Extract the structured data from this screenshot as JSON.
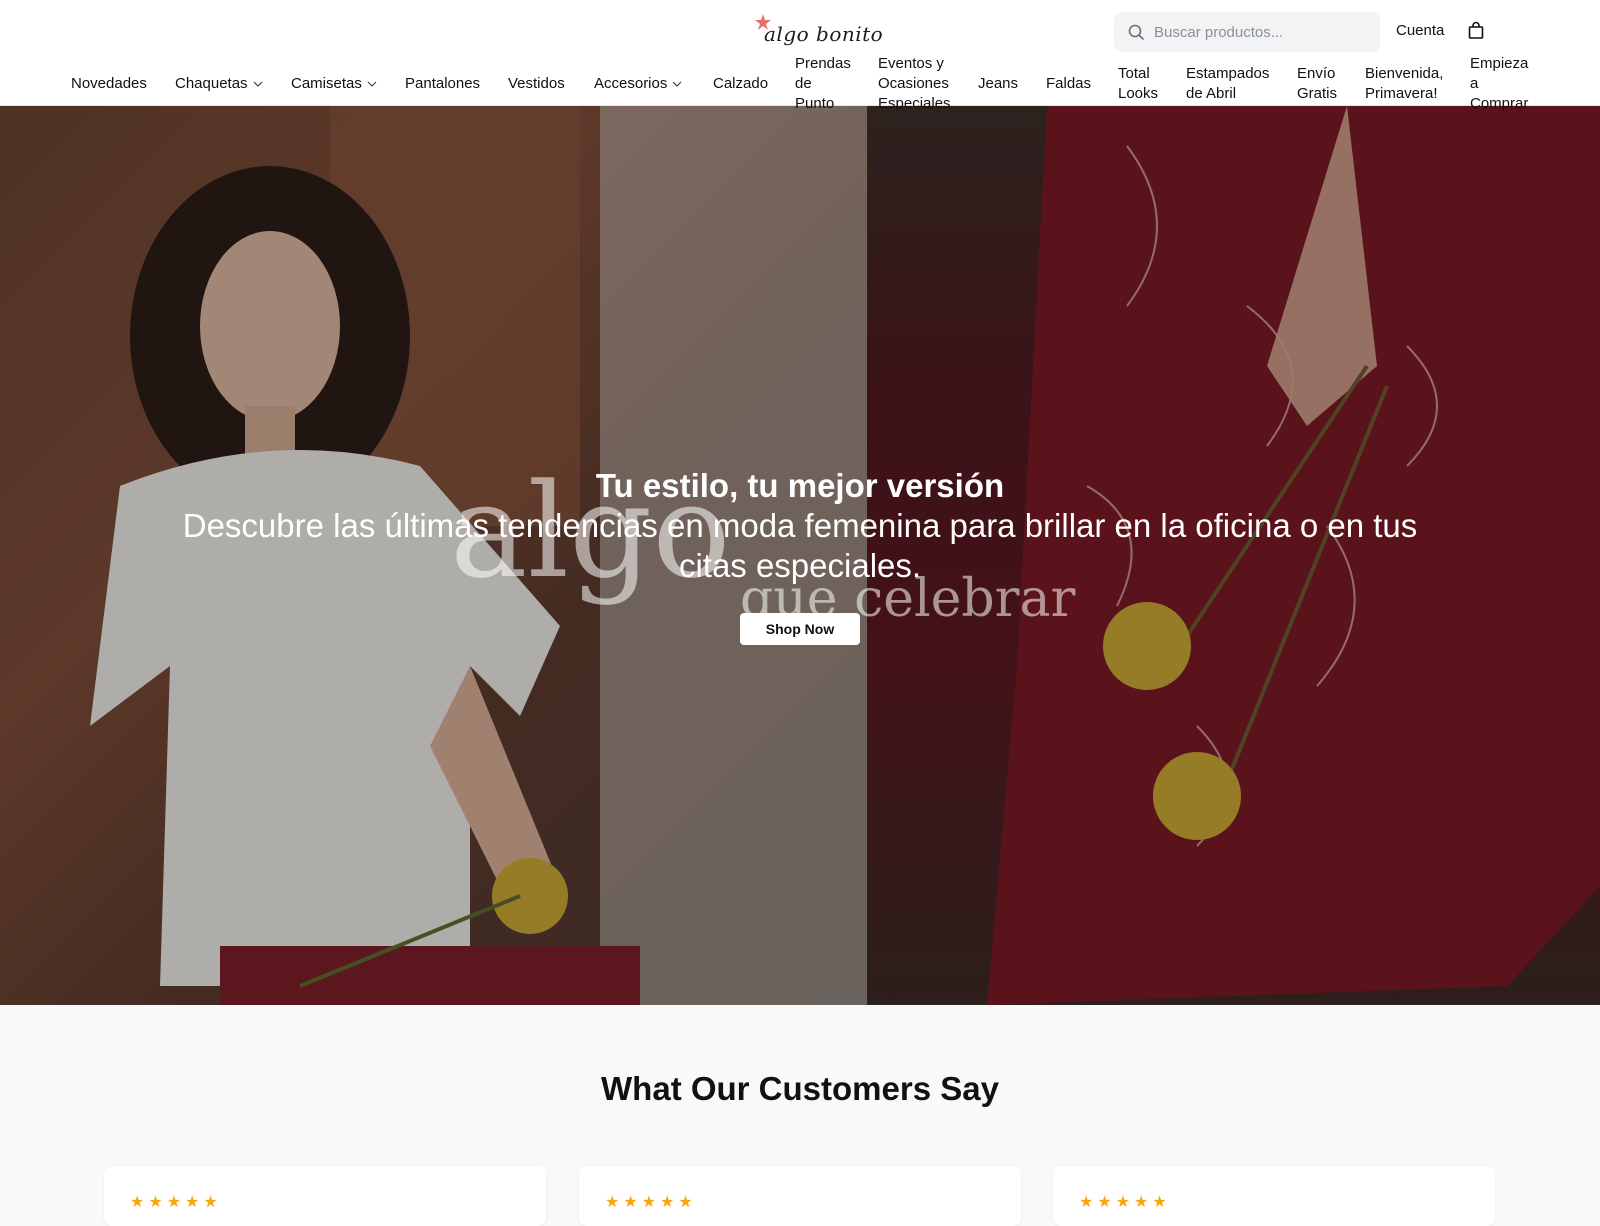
{
  "brand": {
    "name": "algo bonito"
  },
  "search": {
    "placeholder": "Buscar productos..."
  },
  "account": {
    "label": "Cuenta"
  },
  "nav": {
    "items": [
      {
        "label": "Novedades"
      },
      {
        "label": "Chaquetas",
        "dropdown": true
      },
      {
        "label": "Camisetas",
        "dropdown": true
      },
      {
        "label": "Pantalones"
      },
      {
        "label": "Vestidos"
      },
      {
        "label": "Accesorios",
        "dropdown": true
      },
      {
        "label": "Calzado"
      },
      {
        "label": "Prendas de Punto"
      },
      {
        "label": "Eventos y Ocasiones Especiales"
      },
      {
        "label": "Jeans"
      },
      {
        "label": "Faldas"
      },
      {
        "label": "Total Looks"
      },
      {
        "label": "Estampados de Abril"
      },
      {
        "label": "Envío Gratis"
      },
      {
        "label": "Bienvenida, Primavera!"
      },
      {
        "label": "Empieza a Comprar"
      }
    ]
  },
  "hero": {
    "title": "Tu estilo, tu mejor versión",
    "subtitle": "Descubre las últimas tendencias en moda femenina para brillar en la oficina o en tus citas especiales.",
    "button": "Shop Now",
    "image_text_1": "algo",
    "image_text_2": "que celebrar"
  },
  "testimonials": {
    "title": "What Our Customers Say",
    "cards": [
      {
        "rating": 5
      },
      {
        "rating": 5
      },
      {
        "rating": 5
      }
    ]
  },
  "colors": {
    "star": "#f6a70f",
    "logo_accent": "#e8706b"
  }
}
